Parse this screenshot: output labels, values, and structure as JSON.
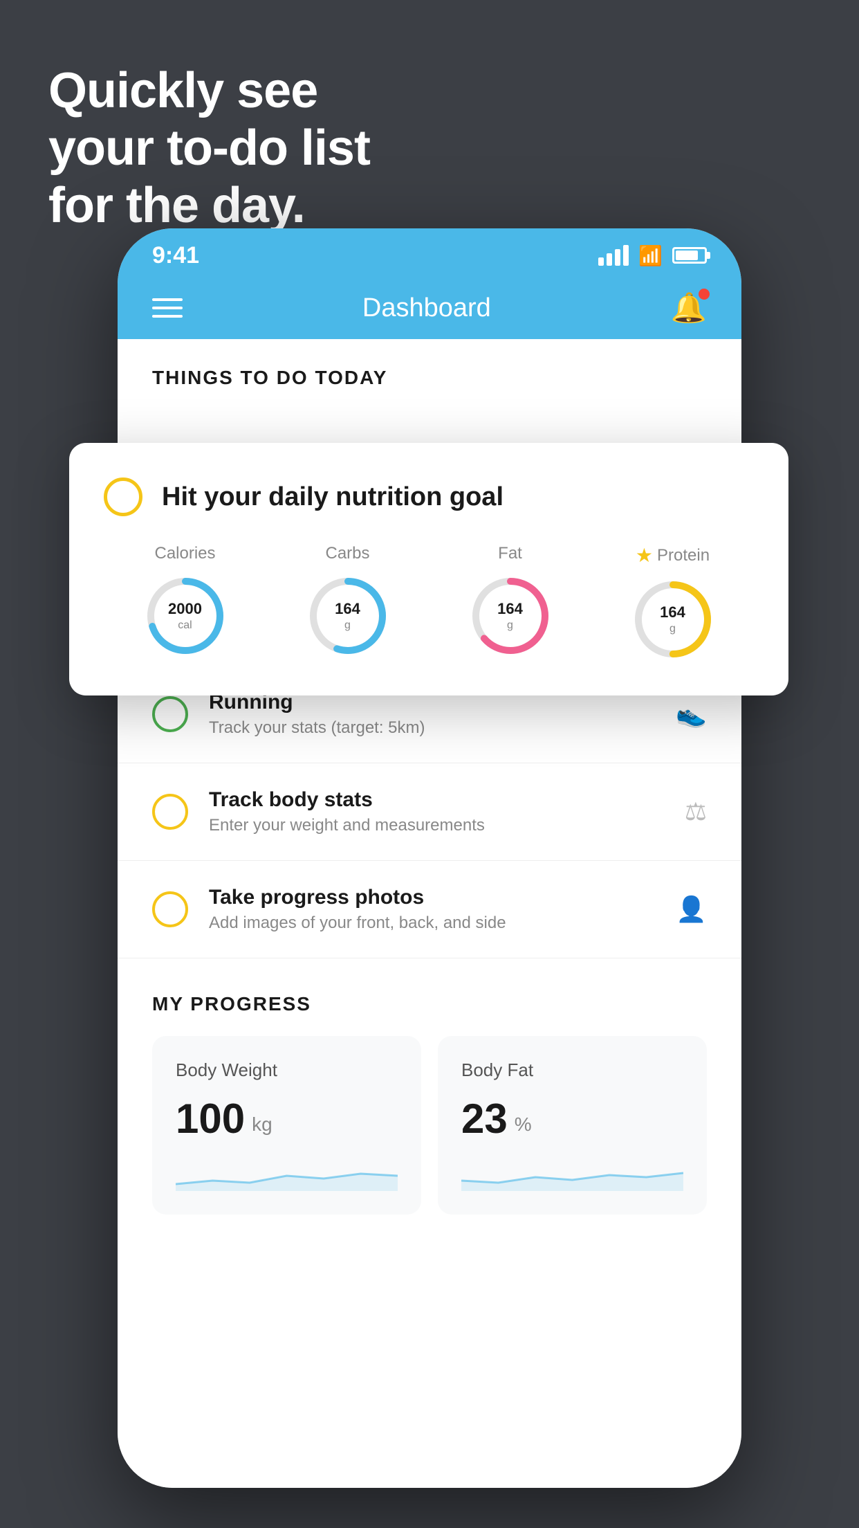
{
  "background": {
    "color": "#3c3f45"
  },
  "hero": {
    "line1": "Quickly see",
    "line2": "your to-do list",
    "line3": "for the day."
  },
  "phone": {
    "statusBar": {
      "time": "9:41"
    },
    "navBar": {
      "title": "Dashboard"
    },
    "sectionHeading": "THINGS TO DO TODAY",
    "floatingCard": {
      "checkCircleColor": "#f5c518",
      "title": "Hit your daily nutrition goal",
      "nutrition": [
        {
          "label": "Calories",
          "value": "2000",
          "unit": "cal",
          "color": "#4ab8e8",
          "progress": 0.7,
          "starred": false
        },
        {
          "label": "Carbs",
          "value": "164",
          "unit": "g",
          "color": "#4ab8e8",
          "progress": 0.55,
          "starred": false
        },
        {
          "label": "Fat",
          "value": "164",
          "unit": "g",
          "color": "#f06090",
          "progress": 0.65,
          "starred": false
        },
        {
          "label": "Protein",
          "value": "164",
          "unit": "g",
          "color": "#f5c518",
          "progress": 0.5,
          "starred": true
        }
      ]
    },
    "todoItems": [
      {
        "circleColor": "green",
        "title": "Running",
        "subtitle": "Track your stats (target: 5km)",
        "icon": "shoe"
      },
      {
        "circleColor": "yellow",
        "title": "Track body stats",
        "subtitle": "Enter your weight and measurements",
        "icon": "scale"
      },
      {
        "circleColor": "yellow",
        "title": "Take progress photos",
        "subtitle": "Add images of your front, back, and side",
        "icon": "person"
      }
    ],
    "progressSection": {
      "heading": "MY PROGRESS",
      "cards": [
        {
          "title": "Body Weight",
          "value": "100",
          "unit": "kg"
        },
        {
          "title": "Body Fat",
          "value": "23",
          "unit": "%"
        }
      ]
    }
  }
}
